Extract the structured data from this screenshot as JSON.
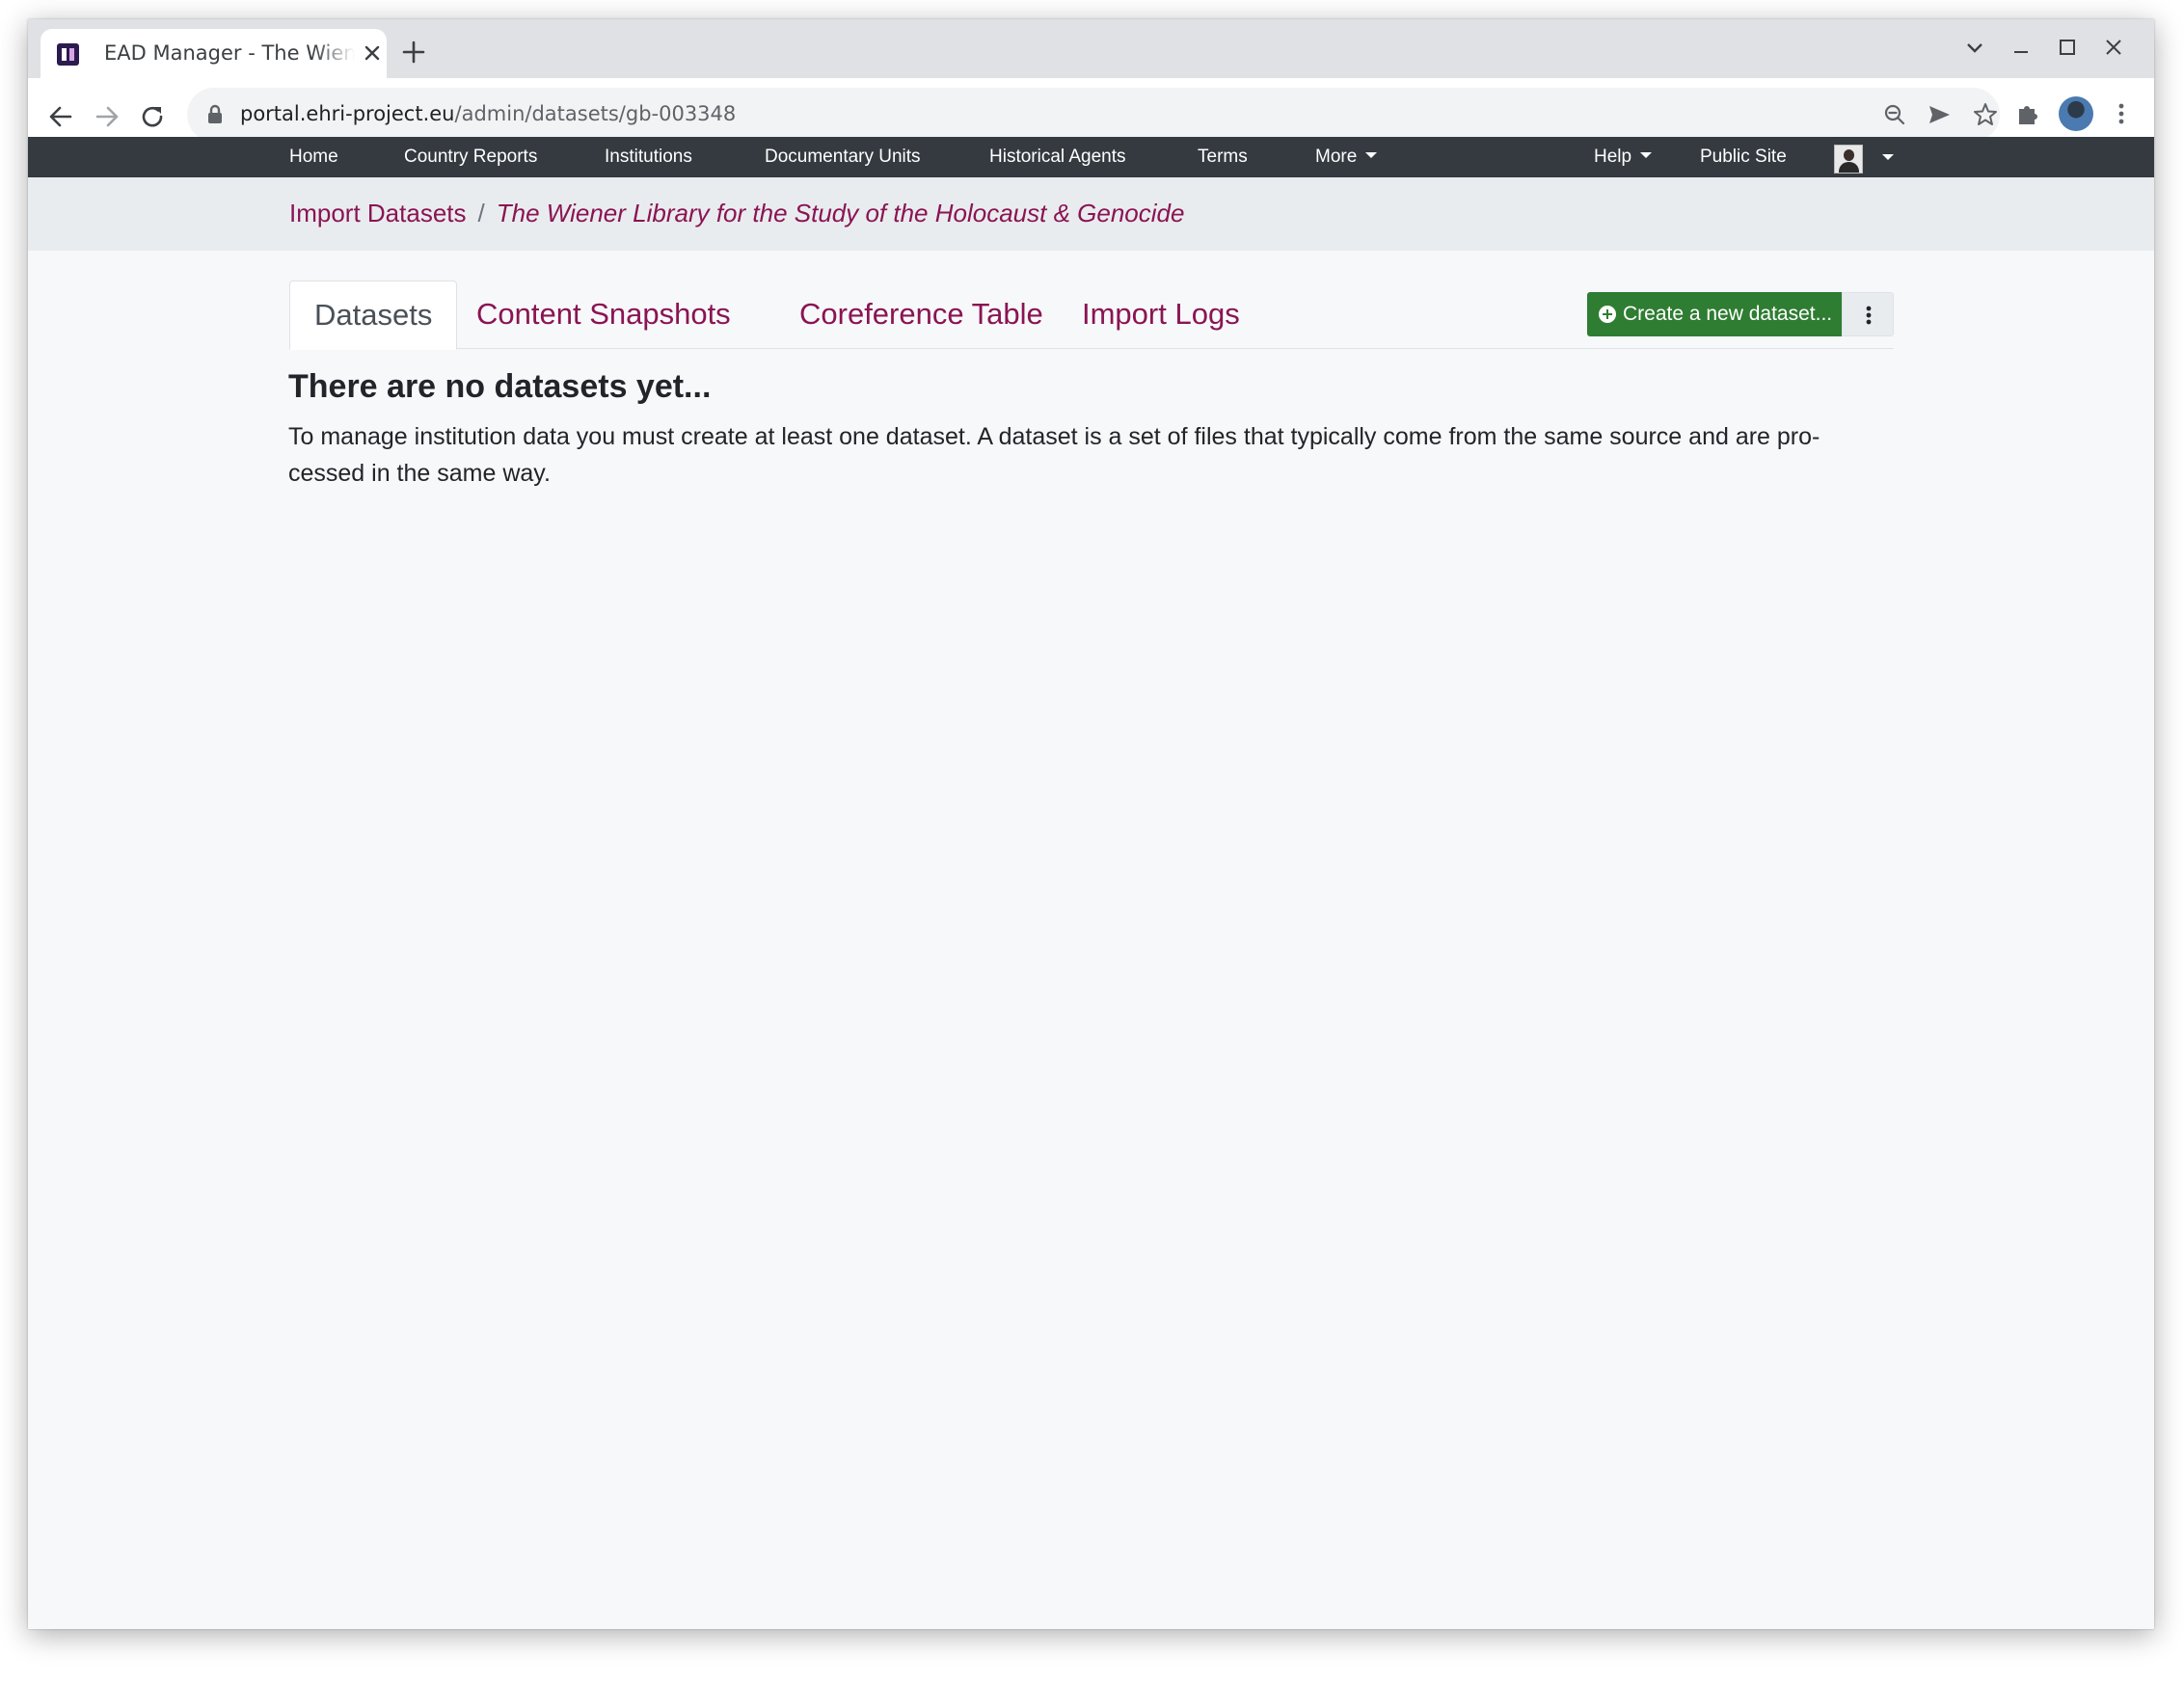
{
  "browser": {
    "tab_title": "EAD Manager - The Wiener Library for the Study of the Holocaust & Genocide",
    "url_host": "portal.ehri-project.eu",
    "url_path": "/admin/datasets/gb-003348"
  },
  "navbar": {
    "items": [
      "Home",
      "Country Reports",
      "Institutions",
      "Documentary Units",
      "Historical Agents",
      "Terms",
      "More"
    ],
    "help": "Help",
    "public_site": "Public Site"
  },
  "breadcrumb": {
    "parent": "Import Datasets",
    "separator": "/",
    "current": "The Wiener Library for the Study of the Holocaust & Genocide"
  },
  "tabs": [
    "Datasets",
    "Content Snapshots",
    "Coreference Table",
    "Import Logs"
  ],
  "actions": {
    "create_label": "Create a new dataset..."
  },
  "content": {
    "heading": "There are no datasets yet...",
    "line1": "To manage institution data you must create at least one dataset. A dataset is a set of files that typically come from the same source and are pro-",
    "line2": "cessed in the same way."
  },
  "colors": {
    "navbar": "#343a40",
    "link": "#8a1453",
    "create_button": "#2e7d32"
  }
}
